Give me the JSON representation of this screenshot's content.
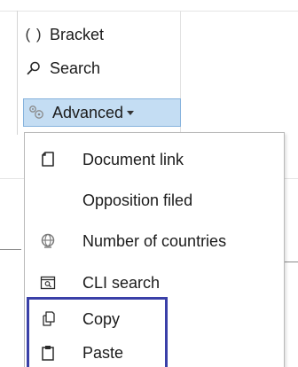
{
  "ribbon": {
    "bracket": {
      "glyph": "( )",
      "label": "Bracket",
      "icon": "bracket-icon"
    },
    "search": {
      "label": "Search",
      "icon": "search-icon"
    },
    "advanced": {
      "label": "Advanced",
      "icon": "advanced-icon",
      "state": "expanded"
    }
  },
  "menu": {
    "items": [
      {
        "label": "Document link",
        "icon": "document-link-icon"
      },
      {
        "label": "Opposition filed",
        "icon": ""
      },
      {
        "label": "Number of countries",
        "icon": "globe-icon"
      },
      {
        "label": "CLI search",
        "icon": "cli-search-icon"
      },
      {
        "label": "Copy",
        "icon": "copy-icon"
      },
      {
        "label": "Paste",
        "icon": "paste-icon"
      }
    ]
  },
  "colors": {
    "advanced_bg": "#c4ddf3",
    "advanced_border": "#86b3dd",
    "highlight_border": "#3a40a8"
  }
}
